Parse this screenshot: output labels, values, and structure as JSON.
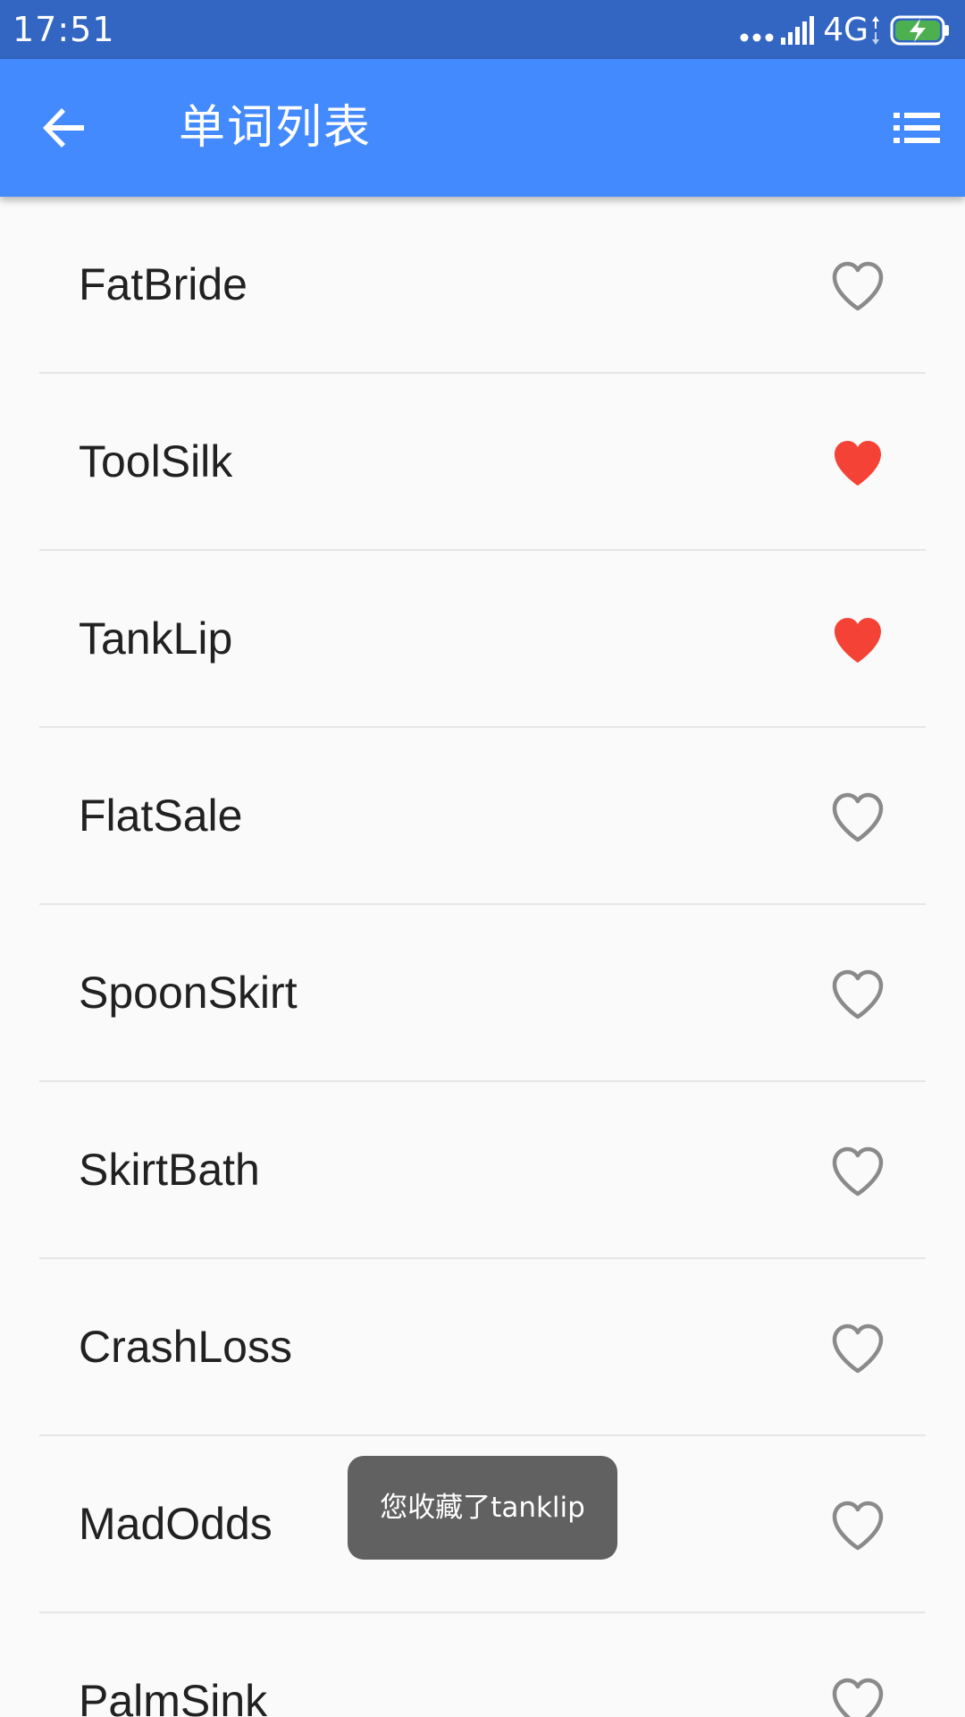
{
  "status_bar": {
    "time": "17:51",
    "network": "4G",
    "icons": [
      "more-dots-icon",
      "signal-icon",
      "network-arrows-icon",
      "battery-charging-icon"
    ]
  },
  "app_bar": {
    "title": "单词列表",
    "back_icon": "arrow-back-icon",
    "menu_icon": "list-menu-icon"
  },
  "words": [
    {
      "text": "FatBride",
      "favorited": false
    },
    {
      "text": "ToolSilk",
      "favorited": true
    },
    {
      "text": "TankLip",
      "favorited": true
    },
    {
      "text": "FlatSale",
      "favorited": false
    },
    {
      "text": "SpoonSkirt",
      "favorited": false
    },
    {
      "text": "SkirtBath",
      "favorited": false
    },
    {
      "text": "CrashLoss",
      "favorited": false
    },
    {
      "text": "MadOdds",
      "favorited": false
    },
    {
      "text": "PalmSink",
      "favorited": false
    }
  ],
  "toast": {
    "message": "您收藏了tanklip"
  },
  "colors": {
    "status_bar": "#3366c2",
    "app_bar": "#448aff",
    "background": "#fafafa",
    "divider": "#e6e6e6",
    "heart_filled": "#f44336",
    "heart_outline": "#8a8a8a",
    "toast_bg": "#616161"
  }
}
